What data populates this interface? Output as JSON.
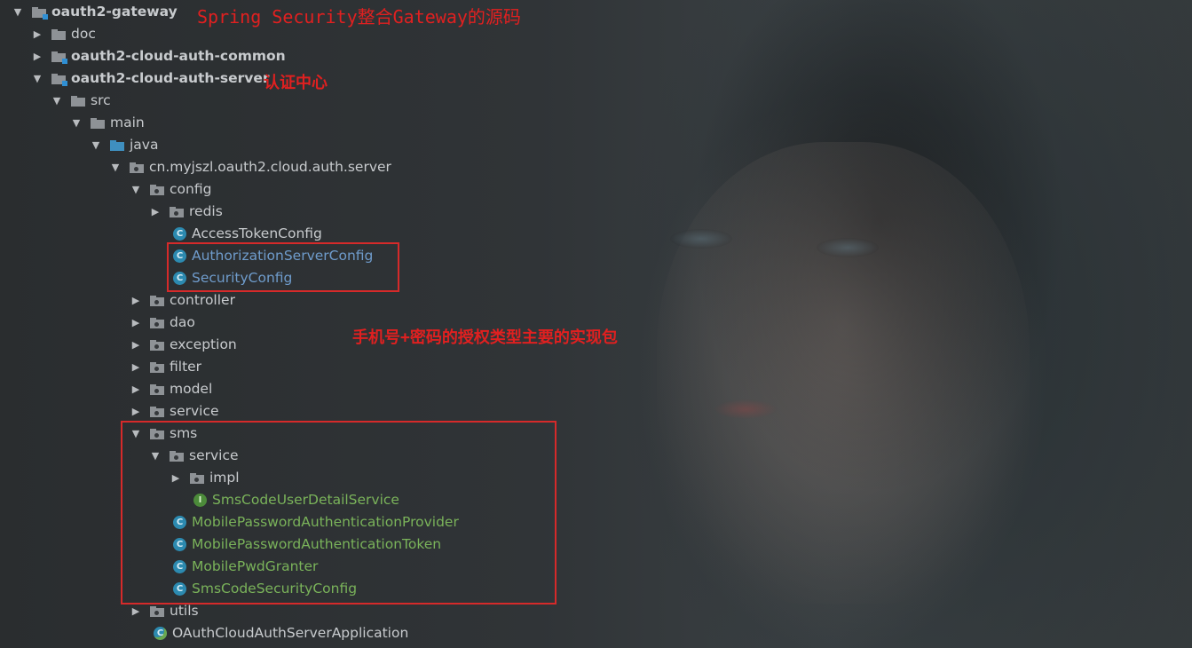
{
  "annotations": {
    "title": "Spring Security整合Gateway的源码",
    "auth_center": "认证中心",
    "sms_note": "手机号+密码的授权类型主要的实现包"
  },
  "tree": {
    "root": "oauth2-gateway",
    "doc": "doc",
    "auth_common": "oauth2-cloud-auth-common",
    "auth_server": "oauth2-cloud-auth-server",
    "src": "src",
    "main": "main",
    "java": "java",
    "package": "cn.myjszl.oauth2.cloud.auth.server",
    "config": "config",
    "redis": "redis",
    "access_token_config": "AccessTokenConfig",
    "authorization_server_config": "AuthorizationServerConfig",
    "security_config": "SecurityConfig",
    "controller": "controller",
    "dao": "dao",
    "exception": "exception",
    "filter": "filter",
    "model": "model",
    "service": "service",
    "sms": "sms",
    "sms_service": "service",
    "impl": "impl",
    "sms_code_user_detail_service": "SmsCodeUserDetailService",
    "mobile_password_auth_provider": "MobilePasswordAuthenticationProvider",
    "mobile_password_auth_token": "MobilePasswordAuthenticationToken",
    "mobile_pwd_granter": "MobilePwdGranter",
    "sms_code_security_config": "SmsCodeSecurityConfig",
    "utils": "utils",
    "application": "OAuthCloudAuthServerApplication"
  },
  "icons": {
    "expanded": "triangle-down",
    "collapsed": "triangle-right",
    "class_letter": "C",
    "interface_letter": "I"
  },
  "colors": {
    "annotation_red": "#e02020",
    "modified_green": "#7ab35a",
    "modified_blue": "#6f9ccc",
    "folder_blue": "#3f8fbf"
  }
}
